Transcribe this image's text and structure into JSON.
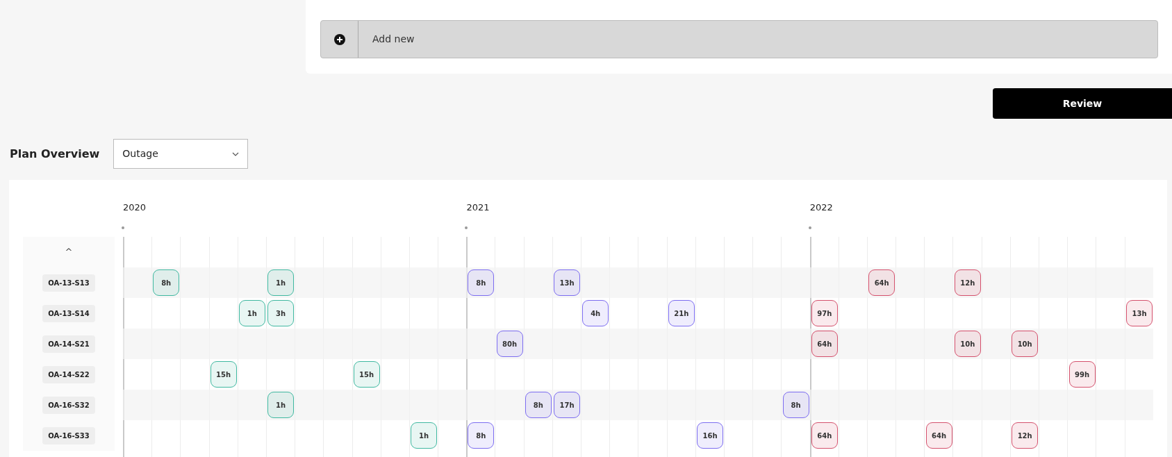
{
  "add_new": {
    "label": "Add new"
  },
  "review_button": "Review",
  "plan_overview": {
    "title": "Plan Overview",
    "select_value": "Outage"
  },
  "timeline": {
    "years": [
      {
        "label": "2020",
        "color": "#3fb8a0"
      },
      {
        "label": "2021",
        "color": "#7c6cf0"
      },
      {
        "label": "2022",
        "color": "#d4506c"
      }
    ],
    "collapse_label": "^",
    "rows": [
      {
        "label": "OA-13-S13",
        "cells": [
          null,
          "8h",
          null,
          null,
          null,
          "1h",
          null,
          null,
          null,
          null,
          null,
          null,
          "8h",
          null,
          null,
          "13h",
          null,
          null,
          null,
          null,
          null,
          null,
          null,
          null,
          null,
          null,
          "64h",
          null,
          null,
          "12h",
          null,
          null,
          null,
          null,
          null,
          null
        ]
      },
      {
        "label": "OA-13-S14",
        "cells": [
          null,
          null,
          null,
          null,
          "1h",
          "3h",
          null,
          null,
          null,
          null,
          null,
          null,
          null,
          null,
          null,
          null,
          "4h",
          null,
          null,
          "21h",
          null,
          null,
          null,
          null,
          "97h",
          null,
          null,
          null,
          null,
          null,
          null,
          null,
          null,
          null,
          null,
          "13h"
        ]
      },
      {
        "label": "OA-14-S21",
        "cells": [
          null,
          null,
          null,
          null,
          null,
          null,
          null,
          null,
          null,
          null,
          null,
          null,
          null,
          "80h",
          null,
          null,
          null,
          null,
          null,
          null,
          null,
          null,
          null,
          null,
          "64h",
          null,
          null,
          null,
          null,
          "10h",
          null,
          "10h",
          null,
          null,
          null,
          null
        ]
      },
      {
        "label": "OA-14-S22",
        "cells": [
          null,
          null,
          null,
          "15h",
          null,
          null,
          null,
          null,
          "15h",
          null,
          null,
          null,
          null,
          null,
          null,
          null,
          null,
          null,
          null,
          null,
          null,
          null,
          null,
          null,
          null,
          null,
          null,
          null,
          null,
          null,
          null,
          null,
          null,
          "99h",
          null,
          null
        ]
      },
      {
        "label": "OA-16-S32",
        "cells": [
          null,
          null,
          null,
          null,
          null,
          "1h",
          null,
          null,
          null,
          null,
          null,
          null,
          null,
          null,
          "8h",
          "17h",
          null,
          null,
          null,
          null,
          null,
          null,
          null,
          "8h",
          null,
          null,
          null,
          null,
          null,
          null,
          null,
          null,
          null,
          null,
          null,
          null
        ]
      },
      {
        "label": "OA-16-S33",
        "cells": [
          null,
          null,
          null,
          null,
          null,
          null,
          null,
          null,
          null,
          null,
          "1h",
          null,
          "8h",
          null,
          null,
          null,
          null,
          null,
          null,
          null,
          "16h",
          null,
          null,
          null,
          "64h",
          null,
          null,
          null,
          "64h",
          null,
          null,
          "12h",
          null,
          null,
          null,
          null
        ]
      }
    ]
  }
}
